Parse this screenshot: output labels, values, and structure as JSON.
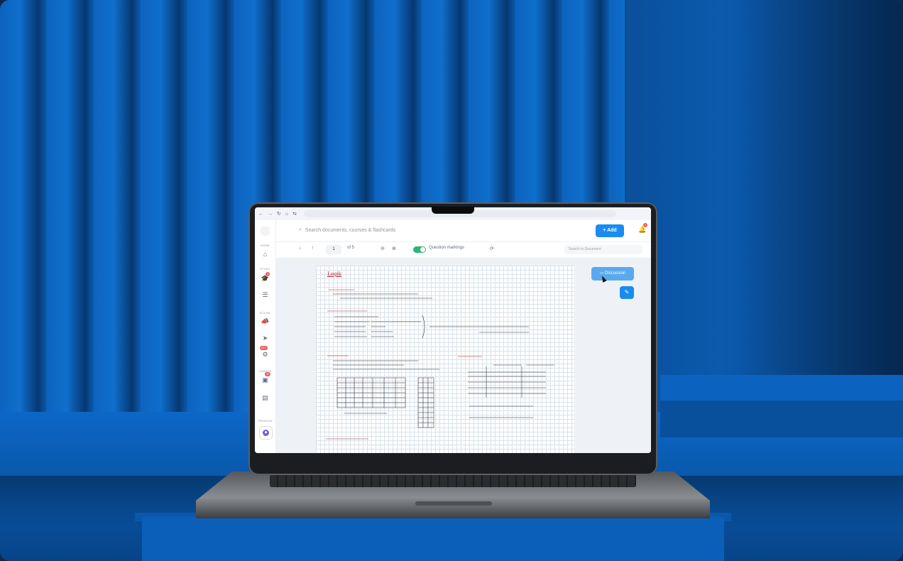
{
  "browser": {
    "nav_icons": [
      "←",
      "→",
      "↻",
      "⌂",
      "⇆"
    ]
  },
  "sidebar": {
    "sections": [
      "HOME",
      "STUDY",
      "SOCIAL",
      "CAREER",
      "PREMIUM"
    ],
    "badges": {
      "study": "3",
      "social": "227",
      "career": "43"
    }
  },
  "topbar": {
    "search_placeholder": "Search documents, courses & flashcards",
    "add_label": "Add",
    "notification_count": "1"
  },
  "toolbar": {
    "current_page": "1",
    "page_total": "of 5",
    "question_markings_label": "Question markings",
    "search_doc_placeholder": "Search in Document"
  },
  "viewer": {
    "discussion_label": "Discussion"
  },
  "document": {
    "title": "Logik"
  }
}
